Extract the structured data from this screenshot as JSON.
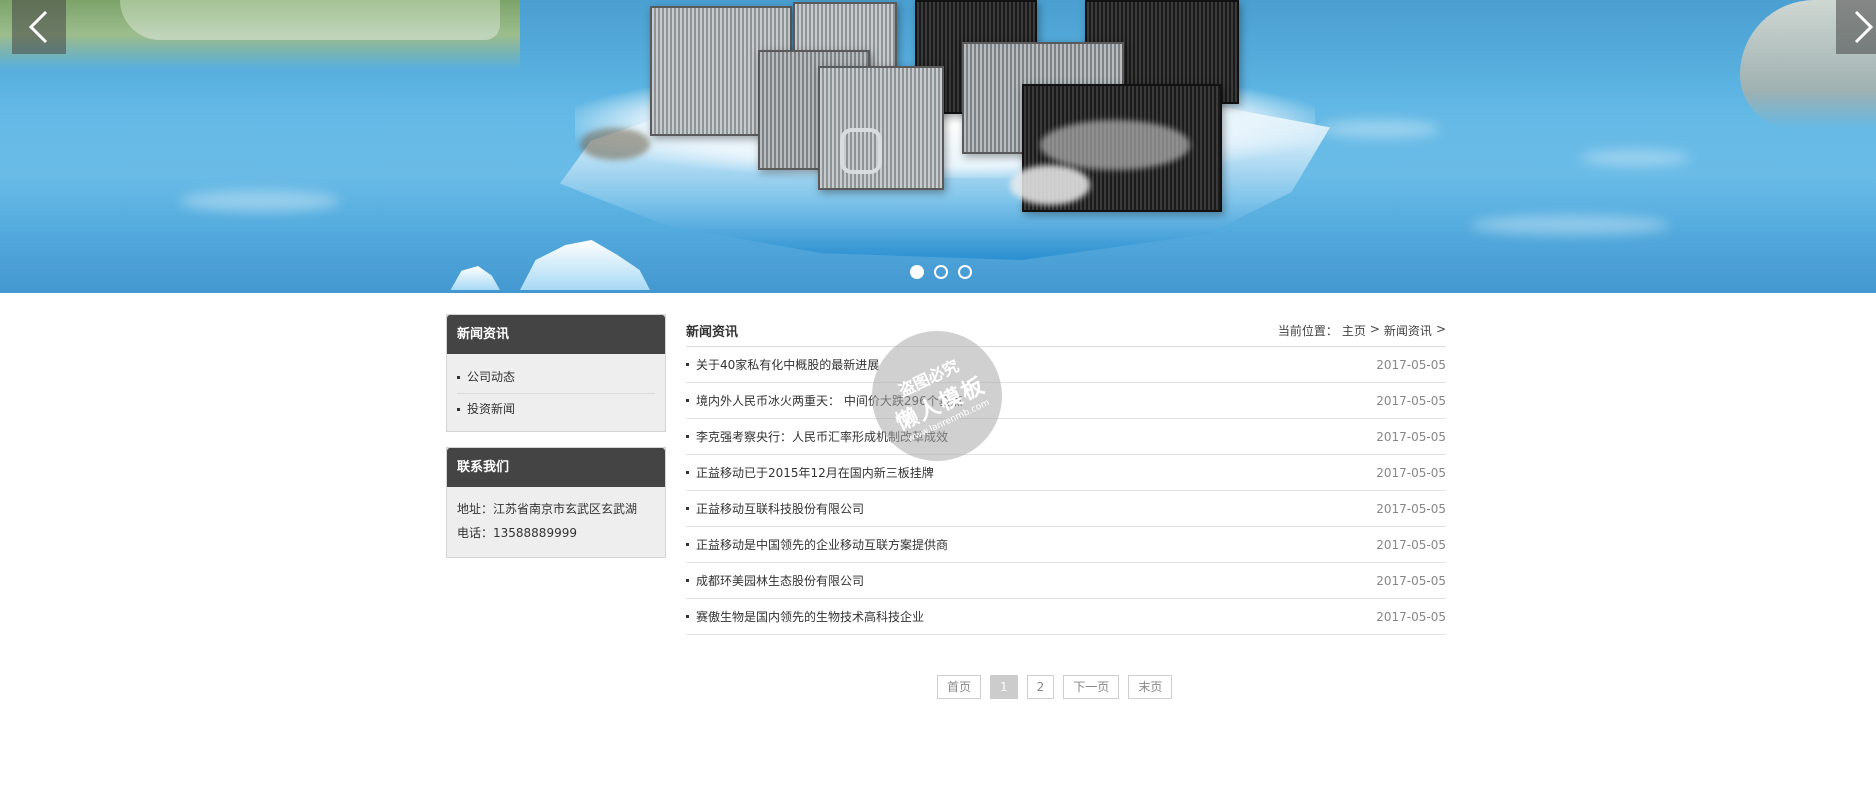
{
  "banner": {
    "prev_icon": "chevron-left-icon",
    "next_icon": "chevron-right-icon",
    "slides": 3,
    "active_slide": 1
  },
  "sidebar": {
    "news_section": {
      "title": "新闻资讯",
      "items": [
        "公司动态",
        "投资新闻"
      ]
    },
    "contact_section": {
      "title": "联系我们",
      "address": "地址：江苏省南京市玄武区玄武湖",
      "phone": "电话：13588889999"
    }
  },
  "main": {
    "title": "新闻资讯",
    "breadcrumb": {
      "prefix": "当前位置：",
      "home": "主页",
      "sep": ">",
      "current": "新闻资讯"
    },
    "news": [
      {
        "title": "关于40家私有化中概股的最新进展",
        "date": "2017-05-05"
      },
      {
        "title": "境内外人民币冰火两重天： 中间价大跌296个基点",
        "date": "2017-05-05"
      },
      {
        "title": "李克强考察央行：人民币汇率形成机制改革成效",
        "date": "2017-05-05"
      },
      {
        "title": "正益移动已于2015年12月在国内新三板挂牌",
        "date": "2017-05-05"
      },
      {
        "title": "正益移动互联科技股份有限公司",
        "date": "2017-05-05"
      },
      {
        "title": "正益移动是中国领先的企业移动互联方案提供商",
        "date": "2017-05-05"
      },
      {
        "title": "成都环美园林生态股份有限公司",
        "date": "2017-05-05"
      },
      {
        "title": "赛傲生物是国内领先的生物技术高科技企业",
        "date": "2017-05-05"
      }
    ]
  },
  "pagination": {
    "first": "首页",
    "pages": [
      "1",
      "2"
    ],
    "current": "1",
    "next": "下一页",
    "last": "末页"
  },
  "watermark": {
    "line1": "盗图必究",
    "line2": "懒人模板",
    "line3": "www.lanrenmb.com"
  }
}
